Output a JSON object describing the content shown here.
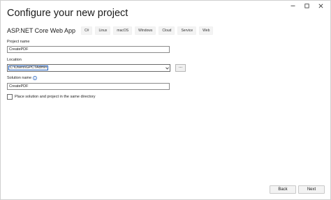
{
  "window": {
    "controls": {
      "minimize_icon": "minimize-icon",
      "maximize_icon": "maximize-icon",
      "close_icon": "close-icon"
    }
  },
  "header": {
    "title": "Configure your new project"
  },
  "template": {
    "name": "ASP.NET Core Web App",
    "tags": [
      "C#",
      "Linux",
      "macOS",
      "Windows",
      "Cloud",
      "Service",
      "Web"
    ]
  },
  "form": {
    "project_name": {
      "label": "Project name",
      "value": "CreatePDF"
    },
    "location": {
      "label": "Location",
      "value": "C:\\Users\\GPCTAdmin",
      "browse_label": "..."
    },
    "solution_name": {
      "label": "Solution name",
      "value": "CreatePDF",
      "info_icon": "info-icon"
    },
    "same_directory": {
      "label": "Place solution and project in the same directory",
      "checked": false
    }
  },
  "footer": {
    "back_label": "Back",
    "next_label": "Next"
  },
  "colors": {
    "accent": "#1f5fbf",
    "border": "#8a8a8a",
    "button_bg": "#f3f3f3"
  }
}
